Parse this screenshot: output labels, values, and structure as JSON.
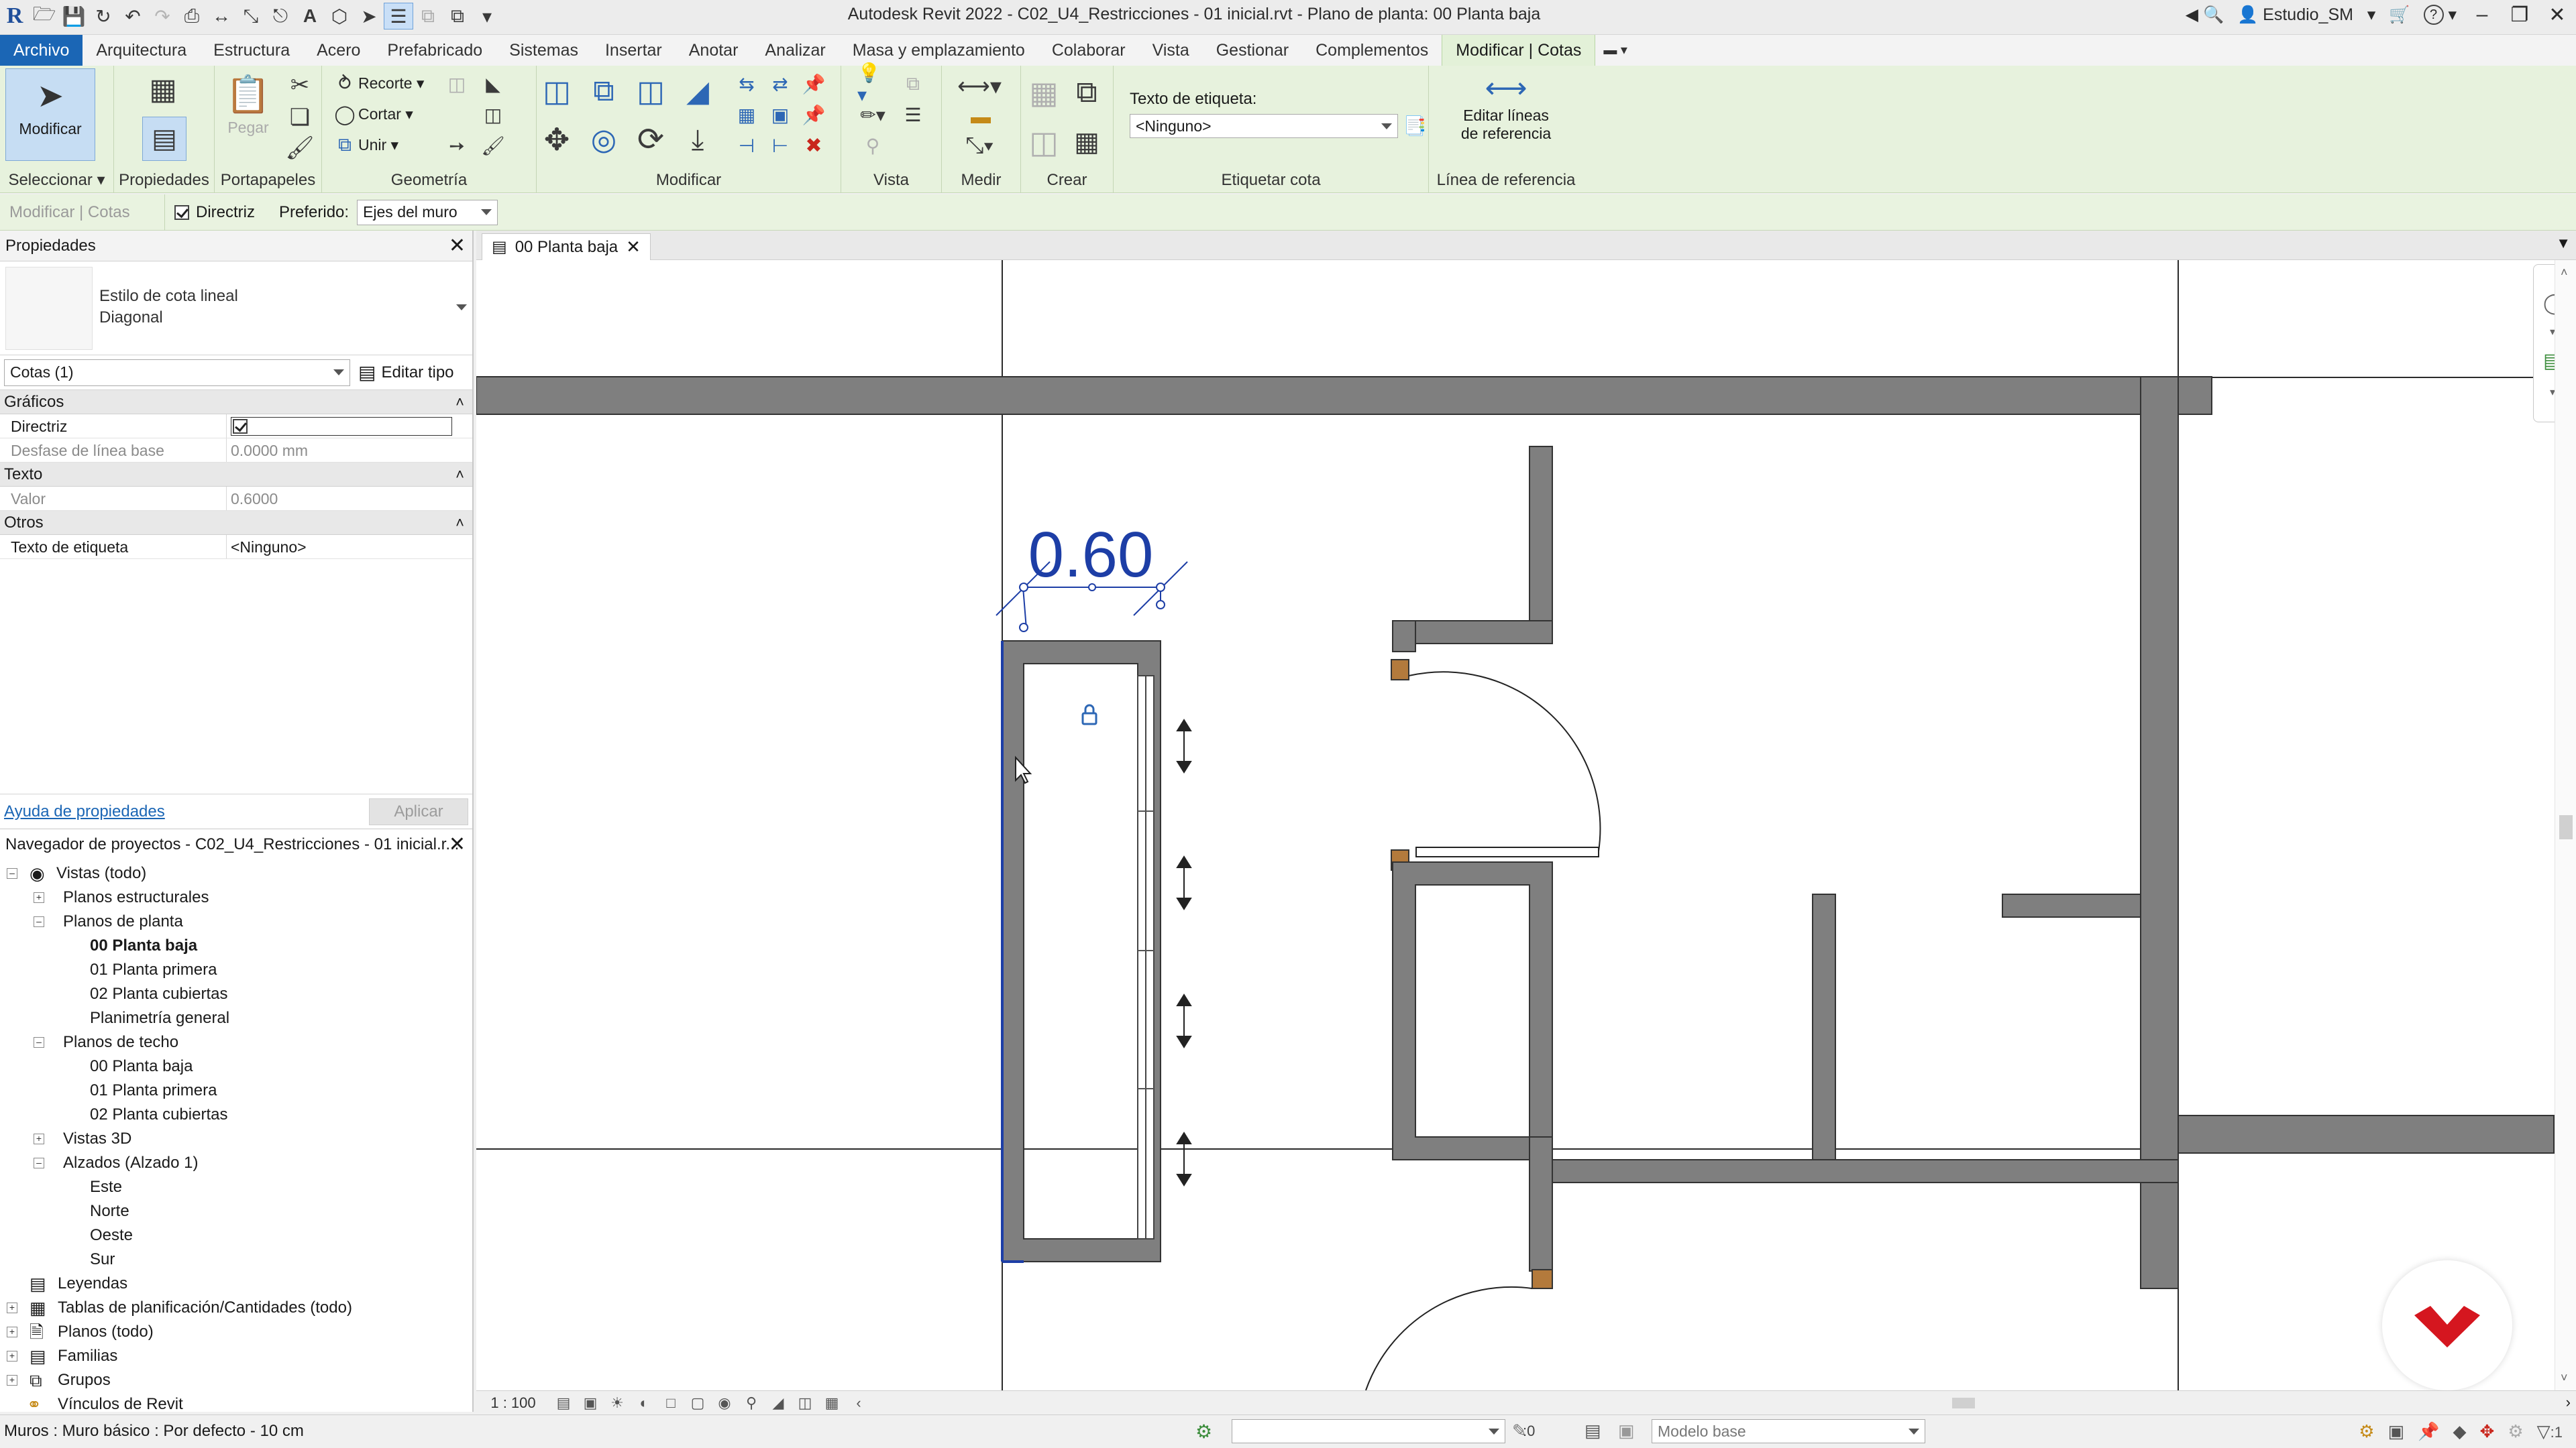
{
  "window": {
    "title": "Autodesk Revit 2022 - C02_U4_Restricciones - 01 inicial.rvt - Plano de planta: 00 Planta baja",
    "user": "Estudio_SM",
    "help": "?"
  },
  "menu_tabs": [
    "Archivo",
    "Arquitectura",
    "Estructura",
    "Acero",
    "Prefabricado",
    "Sistemas",
    "Insertar",
    "Anotar",
    "Analizar",
    "Masa y emplazamiento",
    "Colaborar",
    "Vista",
    "Gestionar",
    "Complementos",
    "Modificar | Cotas"
  ],
  "ribbon": {
    "modify_label": "Modificar",
    "paste_label": "Pegar",
    "cope_label": "Recorte",
    "cut_label": "Cortar",
    "join_label": "Unir",
    "label_text_caption": "Texto de etiqueta:",
    "label_text_value": "<Ninguno>",
    "edit_witness_1": "Editar líneas",
    "edit_witness_2": "de referencia",
    "panels": {
      "select": "Seleccionar",
      "properties": "Propiedades",
      "clipboard": "Portapapeles",
      "geometry": "Geometría",
      "modify": "Modificar",
      "view": "Vista",
      "measure": "Medir",
      "create": "Crear",
      "label_dim": "Etiquetar cota",
      "witness": "Línea de referencia"
    }
  },
  "options_bar": {
    "context": "Modificar | Cotas",
    "leader_label": "Directriz",
    "preferred_label": "Preferido:",
    "preferred_value": "Ejes del muro"
  },
  "properties": {
    "header": "Propiedades",
    "type_line1": "Estilo de cota lineal",
    "type_line2": "Diagonal",
    "instance_filter": "Cotas (1)",
    "edit_type": "Editar tipo",
    "groups": {
      "graphics": "Gráficos",
      "text": "Texto",
      "other": "Otros"
    },
    "rows": {
      "leader_key": "Directriz",
      "baseline_key": "Desfase de línea base",
      "baseline_val": "0.0000 mm",
      "value_key": "Valor",
      "value_val": "0.6000",
      "label_key": "Texto de etiqueta",
      "label_val": "<Ninguno>"
    },
    "help_link": "Ayuda de propiedades",
    "apply": "Aplicar"
  },
  "browser": {
    "header": "Navegador de proyectos - C02_U4_Restricciones - 01 inicial.r...",
    "nodes": {
      "views": "Vistas (todo)",
      "structural": "Planos estructurales",
      "floor_plans": "Planos de planta",
      "fp0": "00 Planta baja",
      "fp1": "01 Planta primera",
      "fp2": "02 Planta cubiertas",
      "fp3": "Planimetría general",
      "ceiling": "Planos de techo",
      "cp0": "00 Planta baja",
      "cp1": "01 Planta primera",
      "cp2": "02 Planta cubiertas",
      "views3d": "Vistas 3D",
      "elev": "Alzados (Alzado 1)",
      "e1": "Este",
      "e2": "Norte",
      "e3": "Oeste",
      "e4": "Sur",
      "legends": "Leyendas",
      "schedules": "Tablas de planificación/Cantidades (todo)",
      "sheets": "Planos (todo)",
      "families": "Familias",
      "groups": "Grupos",
      "links": "Vínculos de Revit"
    }
  },
  "view": {
    "tab": "00 Planta baja",
    "dimension_text": "0.60",
    "scale": "1 : 100"
  },
  "status": {
    "message": "Muros : Muro básico : Por defecto - 10 cm",
    "counter": ":0",
    "model": "Modelo base",
    "filter": ":1"
  },
  "colors": {
    "archivo_bg": "#1b66b5",
    "ribbon_bg": "#e7f2dd",
    "wall_fill": "#7f7f7f",
    "dimension_blue": "#1d3ea6",
    "logo_red": "#d5161f"
  }
}
